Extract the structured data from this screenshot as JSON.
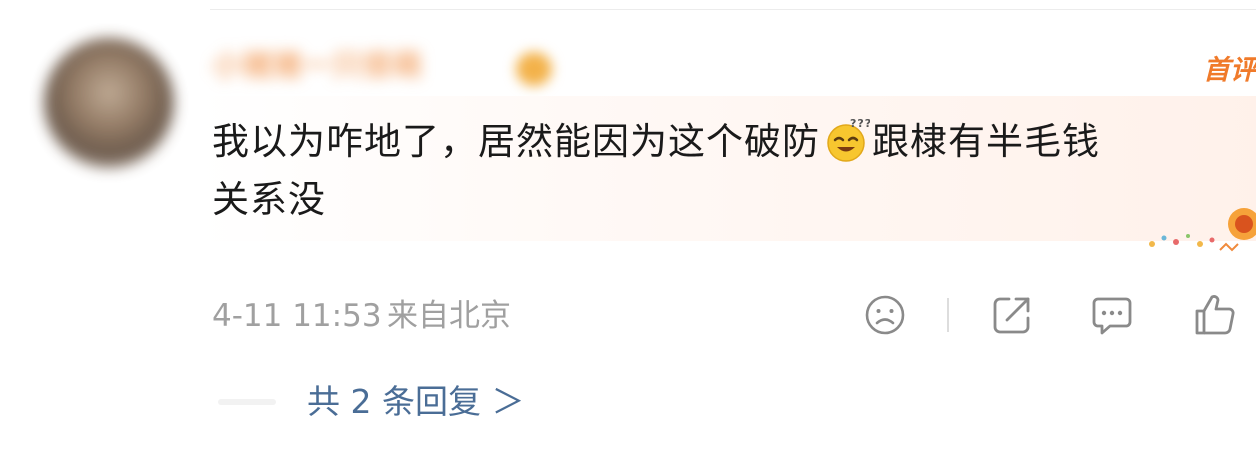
{
  "comment": {
    "username": "小猪猪一只很萌",
    "first_comment_badge": "首评",
    "text_line1_a": "我以为咋地了，居然能因为这个破防",
    "text_line1_b": "跟棣有半毛钱",
    "text_line2": "关系没",
    "emoji": "dizzy-smile-emoji",
    "time": "4-11 11:53",
    "location": "来自北京",
    "replies_link": "共 2 条回复 ＞"
  },
  "actions": {
    "icons": [
      "dislike-face-icon",
      "share-icon",
      "comment-icon",
      "like-thumb-icon"
    ]
  },
  "colors": {
    "badge": "#f07a2a",
    "link": "#4a6d96",
    "meta": "#a0a0a0",
    "text": "#1a1a1a"
  }
}
